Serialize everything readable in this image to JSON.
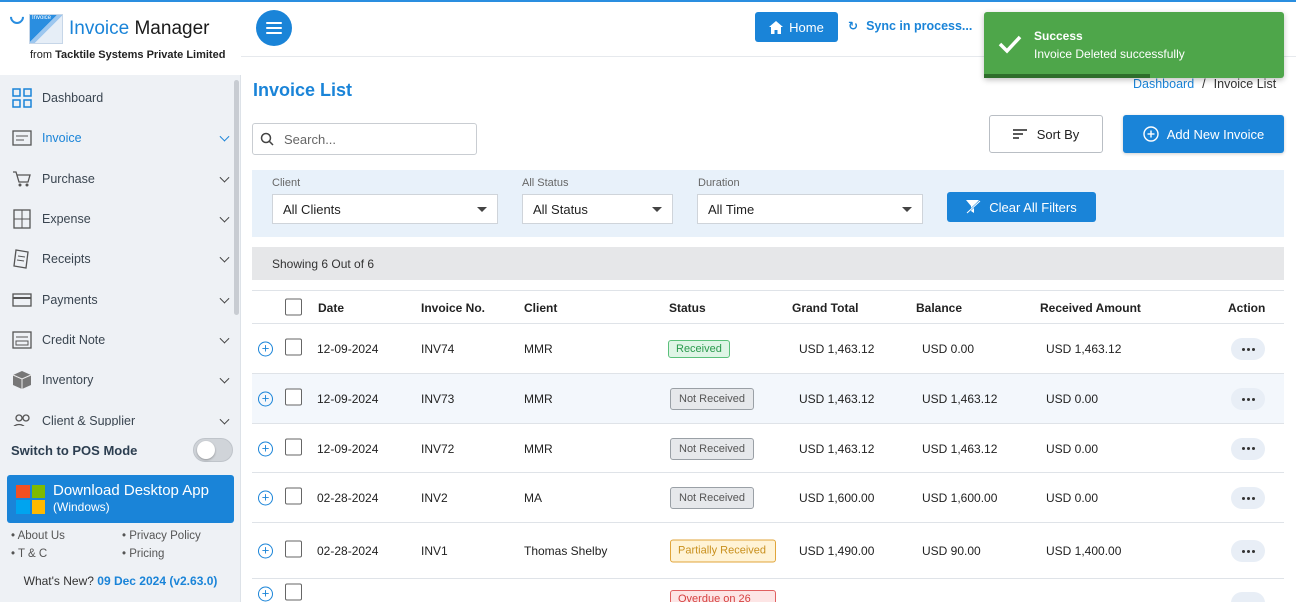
{
  "brand": {
    "logo_tag": "Invoice",
    "title_part1": "Invoice",
    "title_part2": " Manager",
    "subtitle_prefix": "from ",
    "subtitle_company": "Tacktile Systems Private Limited"
  },
  "sidebar": {
    "items": [
      {
        "label": "Dashboard",
        "icon": "dashboard-grid-icon",
        "active": false,
        "chevron": false
      },
      {
        "label": "Invoice",
        "icon": "invoice-icon",
        "active": true,
        "chevron": true
      },
      {
        "label": "Purchase",
        "icon": "cart-icon",
        "active": false,
        "chevron": true
      },
      {
        "label": "Expense",
        "icon": "calculator-icon",
        "active": false,
        "chevron": true
      },
      {
        "label": "Receipts",
        "icon": "receipt-icon",
        "active": false,
        "chevron": true
      },
      {
        "label": "Payments",
        "icon": "card-icon",
        "active": false,
        "chevron": true
      },
      {
        "label": "Credit Note",
        "icon": "credit-note-icon",
        "active": false,
        "chevron": true
      },
      {
        "label": "Inventory",
        "icon": "box-icon",
        "active": false,
        "chevron": true
      },
      {
        "label": "Client & Supplier",
        "icon": "people-icon",
        "active": false,
        "chevron": true
      }
    ],
    "pos_label": "Switch to POS Mode",
    "pos_enabled": false,
    "download": {
      "title": "Download Desktop App",
      "sub": "(Windows)"
    },
    "links": [
      "About Us",
      "Privacy Policy",
      "T & C",
      "Pricing"
    ],
    "whats_new_label": "What's New?",
    "whats_new_version": "09 Dec 2024 (v2.63.0)"
  },
  "header": {
    "home_label": "Home",
    "sync_label": "Sync in process..."
  },
  "toast": {
    "title": "Success",
    "message": "Invoice Deleted successfully",
    "color": "#4ea64a"
  },
  "page": {
    "title": "Invoice List",
    "breadcrumb_link": "Dashboard",
    "breadcrumb_sep": "/",
    "breadcrumb_current": "Invoice List",
    "search_placeholder": "Search...",
    "sort_label": "Sort By",
    "add_label": "Add New Invoice"
  },
  "filters": {
    "client": {
      "label": "Client",
      "value": "All Clients"
    },
    "status": {
      "label": "All Status",
      "value": "All Status"
    },
    "duration": {
      "label": "Duration",
      "value": "All Time"
    },
    "clear_label": "Clear All Filters"
  },
  "showing": "Showing 6 Out of 6",
  "table": {
    "columns": [
      "Date",
      "Invoice No.",
      "Client",
      "Status",
      "Grand Total",
      "Balance",
      "Received Amount",
      "Action"
    ],
    "rows": [
      {
        "date": "12-09-2024",
        "invoice": "INV74",
        "client": "MMR",
        "status": "Received",
        "status_type": "received",
        "grand_total": "USD 1,463.12",
        "balance": "USD 0.00",
        "received": "USD 1,463.12"
      },
      {
        "date": "12-09-2024",
        "invoice": "INV73",
        "client": "MMR",
        "status": "Not Received",
        "status_type": "not",
        "grand_total": "USD 1,463.12",
        "balance": "USD 1,463.12",
        "received": "USD 0.00"
      },
      {
        "date": "12-09-2024",
        "invoice": "INV72",
        "client": "MMR",
        "status": "Not Received",
        "status_type": "not",
        "grand_total": "USD 1,463.12",
        "balance": "USD 1,463.12",
        "received": "USD 0.00"
      },
      {
        "date": "02-28-2024",
        "invoice": "INV2",
        "client": "MA",
        "status": "Not Received",
        "status_type": "not",
        "grand_total": "USD 1,600.00",
        "balance": "USD 1,600.00",
        "received": "USD 0.00"
      },
      {
        "date": "02-28-2024",
        "invoice": "INV1",
        "client": "Thomas Shelby",
        "status": "Partially Received",
        "status_type": "partial",
        "grand_total": "USD 1,490.00",
        "balance": "USD 90.00",
        "received": "USD 1,400.00"
      },
      {
        "date": "",
        "invoice": "",
        "client": "",
        "status": "Overdue on 26",
        "status_type": "overdue",
        "grand_total": "",
        "balance": "",
        "received": ""
      }
    ]
  },
  "colors": {
    "accent": "#1a84d8",
    "success": "#4ea64a"
  }
}
